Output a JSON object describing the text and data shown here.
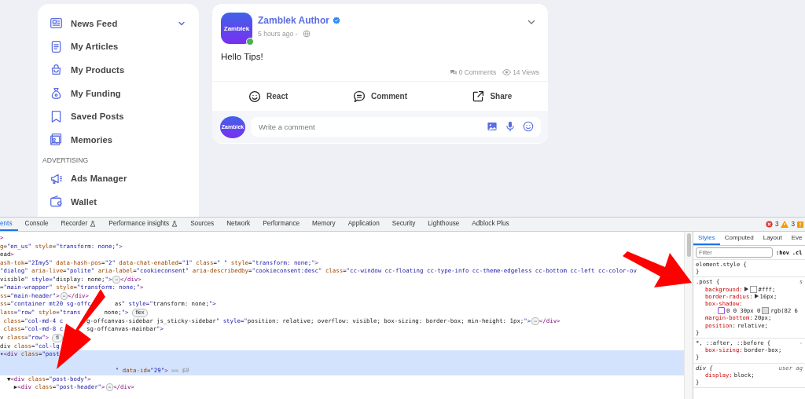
{
  "sidebar": {
    "items": [
      {
        "label": "News Feed",
        "expandable": true
      },
      {
        "label": "My Articles"
      },
      {
        "label": "My Products"
      },
      {
        "label": "My Funding"
      },
      {
        "label": "Saved Posts"
      },
      {
        "label": "Memories"
      }
    ],
    "section": "ADVERTISING",
    "section_items": [
      {
        "label": "Ads Manager"
      },
      {
        "label": "Wallet"
      }
    ]
  },
  "post": {
    "avatar_text": "Zamblek",
    "online": true,
    "author": "Zamblek Author",
    "verified": true,
    "time": "5 hours ago -",
    "body": "Hello Tips!",
    "comments": "0 Comments",
    "views": "14 Views",
    "actions": [
      {
        "label": "React"
      },
      {
        "label": "Comment"
      },
      {
        "label": "Share"
      }
    ],
    "commenter_avatar_text": "Zamblek",
    "comment_placeholder": "Write a comment"
  },
  "devtools": {
    "tabs": [
      {
        "label": "ents",
        "selected": true
      },
      {
        "label": "Console",
        "selected": false
      },
      {
        "label": "Recorder",
        "selected": false,
        "flask": true
      },
      {
        "label": "Performance insights",
        "selected": false,
        "flask": true
      },
      {
        "label": "Sources",
        "selected": false
      },
      {
        "label": "Network",
        "selected": false
      },
      {
        "label": "Performance",
        "selected": false
      },
      {
        "label": "Memory",
        "selected": false
      },
      {
        "label": "Application",
        "selected": false
      },
      {
        "label": "Security",
        "selected": false
      },
      {
        "label": "Lighthouse",
        "selected": false
      },
      {
        "label": "Adblock Plus",
        "selected": false
      }
    ],
    "errors": "3",
    "warnings": "3",
    "dom_lines": [
      {
        "selected": false,
        "parts": [
          {
            "kind": "code",
            "text": ">"
          }
        ]
      },
      {
        "selected": false,
        "parts": [
          {
            "kind": "code",
            "text": "g=\"en_us\" style=\"transform: none;\">"
          }
        ]
      },
      {
        "selected": false,
        "parts": [
          {
            "kind": "code",
            "text": "ead>"
          }
        ]
      },
      {
        "selected": false,
        "parts": [
          {
            "kind": "code",
            "text": "ash-tok=\"2Imy5\" data-hash-pos=\"2\" data-chat-enabled=\"1\" class=\" \" style=\"transform: none;\">"
          }
        ]
      },
      {
        "selected": false,
        "parts": [
          {
            "kind": "code",
            "text": "\"dialog\" aria-live=\"polite\" aria-label=\"cookieconsent\" aria-describedby=\"cookieconsent:desc\" class=\"cc-window cc-floating cc-type-info cc-theme-edgeless cc-bottom cc-left cc-color-ov"
          }
        ]
      },
      {
        "selected": false,
        "parts": [
          {
            "kind": "code",
            "text": "visible\" style=\"display: none;\">"
          },
          {
            "kind": "ellipsis",
            "text": "⋯"
          },
          {
            "kind": "code",
            "text": "</div>"
          }
        ]
      },
      {
        "selected": false,
        "parts": [
          {
            "kind": "code",
            "text": "=\"main-wrapper\" style=\"transform: none;\">"
          }
        ]
      },
      {
        "selected": false,
        "parts": [
          {
            "kind": "code",
            "text": "ss=\"main-header\">"
          },
          {
            "kind": "ellipsis",
            "text": "⋯"
          },
          {
            "kind": "code",
            "text": "</div>"
          }
        ]
      },
      {
        "selected": false,
        "parts": [
          {
            "kind": "code",
            "text": "ss=\"container mt20 sg-offc"
          },
          {
            "kind": "gap"
          },
          {
            "kind": "code",
            "text": "as\" style=\"transform: none;\">"
          }
        ]
      },
      {
        "selected": false,
        "parts": [
          {
            "kind": "code",
            "text": "lass=\"row\" style=\"trans"
          },
          {
            "kind": "gap"
          },
          {
            "kind": "code",
            "text": "none;\">"
          },
          {
            "kind": "badge",
            "text": "flex"
          }
        ]
      },
      {
        "selected": false,
        "parts": [
          {
            "kind": "code",
            "text": " class=\"col-md-4 c"
          },
          {
            "kind": "gap"
          },
          {
            "kind": "code",
            "text": "g-offcanvas-sidebar js_sticky-sidebar\" style=\"position: relative; overflow: visible; box-sizing: border-box; min-height: 1px;\">"
          },
          {
            "kind": "ellipsis",
            "text": "⋯"
          },
          {
            "kind": "code",
            "text": "</div>"
          }
        ]
      },
      {
        "selected": false,
        "parts": [
          {
            "kind": "code",
            "text": " class=\"col-md-8 c"
          },
          {
            "kind": "gap"
          },
          {
            "kind": "code",
            "text": "sg-offcanvas-mainbar\">"
          }
        ]
      },
      {
        "selected": false,
        "parts": [
          {
            "kind": "code",
            "text": "v class=\"row\">"
          },
          {
            "kind": "badge",
            "text": "fl"
          }
        ]
      },
      {
        "selected": false,
        "parts": [
          {
            "kind": "code",
            "text": "div class=\"col-lg"
          }
        ]
      },
      {
        "selected": true,
        "parts": [
          {
            "kind": "code",
            "text": "▾<div class=\"post\n\n                                 \" data-id=\"29\"> == $0"
          }
        ]
      },
      {
        "selected": false,
        "parts": [
          {
            "kind": "code",
            "text": "  ▼<div class=\"post-body\">"
          }
        ]
      },
      {
        "selected": false,
        "parts": [
          {
            "kind": "code",
            "text": "    ▶<div class=\"post-header\">"
          },
          {
            "kind": "ellipsis",
            "text": "⋯"
          },
          {
            "kind": "code",
            "text": "</div>"
          }
        ]
      }
    ],
    "style_tabs": [
      {
        "label": "Styles",
        "selected": true
      },
      {
        "label": "Computed",
        "selected": false
      },
      {
        "label": "Layout",
        "selected": false
      },
      {
        "label": "Eve",
        "selected": false
      }
    ],
    "filter_placeholder": "Filter",
    "hov": ":hov",
    "cls": ".cl",
    "rules": [
      {
        "selector": "element.style {",
        "italic": false,
        "close": "}"
      },
      {
        "selector": ".post {",
        "source": "s",
        "italic": false,
        "close": "}",
        "declarations": [
          {
            "kind": "color",
            "property": "background:",
            "value": "#fff;",
            "color": "#ffffff"
          },
          {
            "kind": "expandable",
            "property": "border-radius:",
            "value": "16px;"
          },
          {
            "kind": "multiline",
            "property": "box-shadow:",
            "value": "0 0 30px 0",
            "tail": "rgb(82 6"
          },
          {
            "kind": "plain",
            "property": "margin-bottom:",
            "value": "20px;"
          },
          {
            "kind": "plain",
            "property": "position:",
            "value": "relative;"
          }
        ]
      },
      {
        "selector": "*, ::after, ::before {",
        "source": "-",
        "italic": false,
        "close": "}",
        "declarations": [
          {
            "kind": "plain",
            "property": "box-sizing:",
            "value": "border-box;"
          }
        ]
      },
      {
        "selector": "div {",
        "source": "user ag",
        "italic": true,
        "close": "}",
        "declarations": [
          {
            "kind": "plain",
            "property": "display:",
            "value": "block;"
          }
        ]
      }
    ]
  }
}
